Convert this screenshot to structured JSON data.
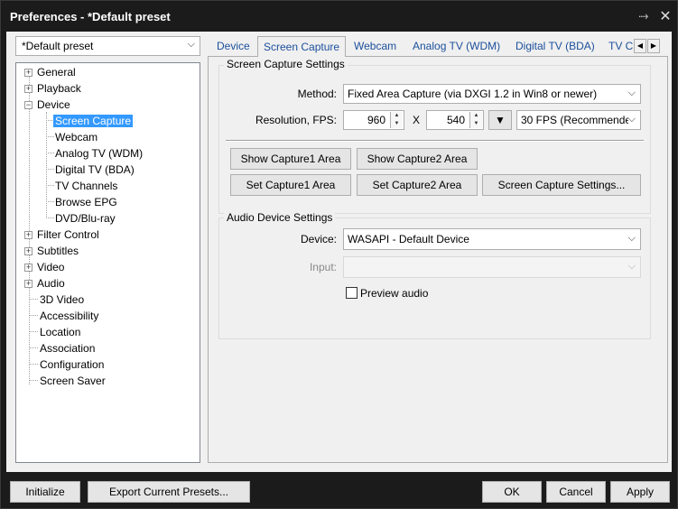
{
  "window": {
    "title": "Preferences - *Default preset"
  },
  "preset": {
    "selected": "*Default preset"
  },
  "tree": [
    {
      "label": "General",
      "expander": "+"
    },
    {
      "label": "Playback",
      "expander": "+"
    },
    {
      "label": "Device",
      "expander": "−"
    },
    {
      "label": "Screen Capture",
      "selected": true
    },
    {
      "label": "Webcam"
    },
    {
      "label": "Analog TV (WDM)"
    },
    {
      "label": "Digital TV (BDA)"
    },
    {
      "label": "TV Channels"
    },
    {
      "label": "Browse EPG"
    },
    {
      "label": "DVD/Blu-ray"
    },
    {
      "label": "Filter Control",
      "expander": "+"
    },
    {
      "label": "Subtitles",
      "expander": "+"
    },
    {
      "label": "Video",
      "expander": "+"
    },
    {
      "label": "Audio",
      "expander": "+"
    },
    {
      "label": "3D Video"
    },
    {
      "label": "Accessibility"
    },
    {
      "label": "Location"
    },
    {
      "label": "Association"
    },
    {
      "label": "Configuration"
    },
    {
      "label": "Screen Saver"
    }
  ],
  "tabs": [
    {
      "label": "Device"
    },
    {
      "label": "Screen Capture",
      "active": true
    },
    {
      "label": "Webcam"
    },
    {
      "label": "Analog TV (WDM)"
    },
    {
      "label": "Digital TV (BDA)"
    },
    {
      "label": "TV C"
    }
  ],
  "screen_capture": {
    "group_title": "Screen Capture Settings",
    "method_label": "Method:",
    "method_value": "Fixed Area Capture (via DXGI 1.2 in Win8 or newer)",
    "resolution_label": "Resolution, FPS:",
    "width": "960",
    "x_sep": "X",
    "height": "540",
    "fps_value": "30 FPS (Recommende",
    "show_capture1": "Show Capture1 Area",
    "show_capture2": "Show Capture2 Area",
    "set_capture1": "Set Capture1 Area",
    "set_capture2": "Set Capture2 Area",
    "settings_button": "Screen Capture Settings..."
  },
  "audio": {
    "group_title": "Audio Device Settings",
    "device_label": "Device:",
    "device_value": "WASAPI - Default Device",
    "input_label": "Input:",
    "input_value": "",
    "preview_label": "Preview audio",
    "preview_checked": false
  },
  "bottom": {
    "initialize": "Initialize",
    "export": "Export Current Presets...",
    "ok": "OK",
    "cancel": "Cancel",
    "apply": "Apply"
  },
  "colors": {
    "title_bg": "#1b1b1b",
    "selection": "#3399ff",
    "tab_text": "#1b4f9c",
    "client_bg": "#f0f0f0"
  }
}
